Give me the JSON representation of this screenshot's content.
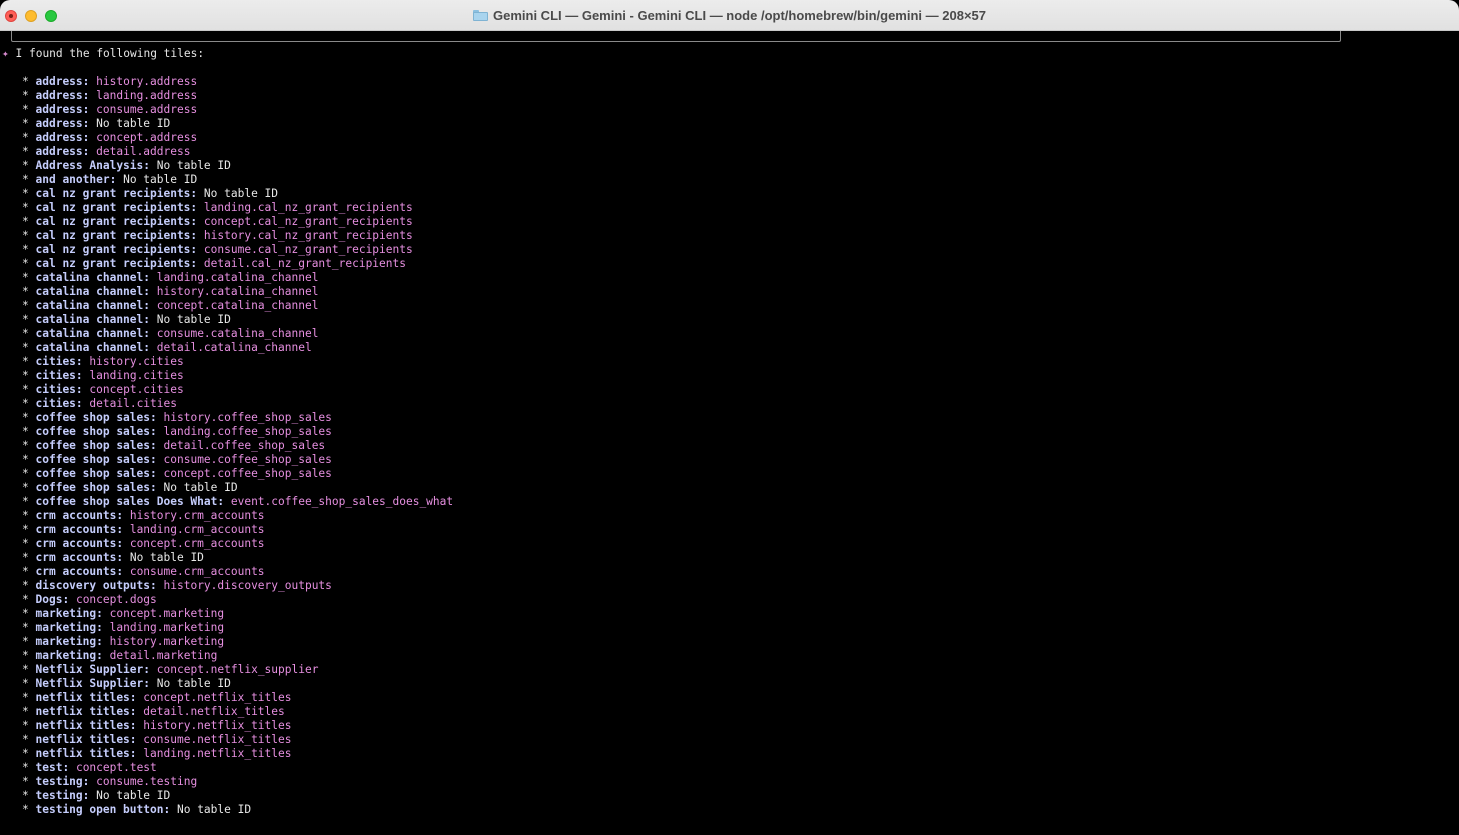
{
  "window": {
    "title": "Gemini CLI — Gemini - Gemini CLI — node /opt/homebrew/bin/gemini — 208×57",
    "folder_icon": "folder-icon"
  },
  "colors": {
    "background": "#000000",
    "key": "#c5cdfc",
    "table_id": "#e68fe0",
    "plain": "#e8e8e8",
    "spark": "#d98bd0"
  },
  "terminal": {
    "spark_glyph": "✦",
    "header": "I found the following tiles:",
    "bullet": "*",
    "items": [
      {
        "name": "address",
        "value": "history.address",
        "style": "pink"
      },
      {
        "name": "address",
        "value": "landing.address",
        "style": "pink"
      },
      {
        "name": "address",
        "value": "consume.address",
        "style": "pink"
      },
      {
        "name": "address",
        "value": "No table ID",
        "style": "white"
      },
      {
        "name": "address",
        "value": "concept.address",
        "style": "pink"
      },
      {
        "name": "address",
        "value": "detail.address",
        "style": "pink"
      },
      {
        "name": "Address Analysis",
        "value": "No table ID",
        "style": "white"
      },
      {
        "name": "and another",
        "value": "No table ID",
        "style": "white"
      },
      {
        "name": "cal nz grant recipients",
        "value": "No table ID",
        "style": "white"
      },
      {
        "name": "cal nz grant recipients",
        "value": "landing.cal_nz_grant_recipients",
        "style": "pink"
      },
      {
        "name": "cal nz grant recipients",
        "value": "concept.cal_nz_grant_recipients",
        "style": "pink"
      },
      {
        "name": "cal nz grant recipients",
        "value": "history.cal_nz_grant_recipients",
        "style": "pink"
      },
      {
        "name": "cal nz grant recipients",
        "value": "consume.cal_nz_grant_recipients",
        "style": "pink"
      },
      {
        "name": "cal nz grant recipients",
        "value": "detail.cal_nz_grant_recipients",
        "style": "pink"
      },
      {
        "name": "catalina channel",
        "value": "landing.catalina_channel",
        "style": "pink"
      },
      {
        "name": "catalina channel",
        "value": "history.catalina_channel",
        "style": "pink"
      },
      {
        "name": "catalina channel",
        "value": "concept.catalina_channel",
        "style": "pink"
      },
      {
        "name": "catalina channel",
        "value": "No table ID",
        "style": "white"
      },
      {
        "name": "catalina channel",
        "value": "consume.catalina_channel",
        "style": "pink"
      },
      {
        "name": "catalina channel",
        "value": "detail.catalina_channel",
        "style": "pink"
      },
      {
        "name": "cities",
        "value": "history.cities",
        "style": "pink"
      },
      {
        "name": "cities",
        "value": "landing.cities",
        "style": "pink"
      },
      {
        "name": "cities",
        "value": "concept.cities",
        "style": "pink"
      },
      {
        "name": "cities",
        "value": "detail.cities",
        "style": "pink"
      },
      {
        "name": "coffee shop sales",
        "value": "history.coffee_shop_sales",
        "style": "pink"
      },
      {
        "name": "coffee shop sales",
        "value": "landing.coffee_shop_sales",
        "style": "pink"
      },
      {
        "name": "coffee shop sales",
        "value": "detail.coffee_shop_sales",
        "style": "pink"
      },
      {
        "name": "coffee shop sales",
        "value": "consume.coffee_shop_sales",
        "style": "pink"
      },
      {
        "name": "coffee shop sales",
        "value": "concept.coffee_shop_sales",
        "style": "pink"
      },
      {
        "name": "coffee shop sales",
        "value": "No table ID",
        "style": "white"
      },
      {
        "name": "coffee shop sales Does What",
        "value": "event.coffee_shop_sales_does_what",
        "style": "pink"
      },
      {
        "name": "crm accounts",
        "value": "history.crm_accounts",
        "style": "pink"
      },
      {
        "name": "crm accounts",
        "value": "landing.crm_accounts",
        "style": "pink"
      },
      {
        "name": "crm accounts",
        "value": "concept.crm_accounts",
        "style": "pink"
      },
      {
        "name": "crm accounts",
        "value": "No table ID",
        "style": "white"
      },
      {
        "name": "crm accounts",
        "value": "consume.crm_accounts",
        "style": "pink"
      },
      {
        "name": "discovery outputs",
        "value": "history.discovery_outputs",
        "style": "pink"
      },
      {
        "name": "Dogs",
        "value": "concept.dogs",
        "style": "pink"
      },
      {
        "name": "marketing",
        "value": "concept.marketing",
        "style": "pink"
      },
      {
        "name": "marketing",
        "value": "landing.marketing",
        "style": "pink"
      },
      {
        "name": "marketing",
        "value": "history.marketing",
        "style": "pink"
      },
      {
        "name": "marketing",
        "value": "detail.marketing",
        "style": "pink"
      },
      {
        "name": "Netflix Supplier",
        "value": "concept.netflix_supplier",
        "style": "pink"
      },
      {
        "name": "Netflix Supplier",
        "value": "No table ID",
        "style": "white"
      },
      {
        "name": "netflix titles",
        "value": "concept.netflix_titles",
        "style": "pink"
      },
      {
        "name": "netflix titles",
        "value": "detail.netflix_titles",
        "style": "pink"
      },
      {
        "name": "netflix titles",
        "value": "history.netflix_titles",
        "style": "pink"
      },
      {
        "name": "netflix titles",
        "value": "consume.netflix_titles",
        "style": "pink"
      },
      {
        "name": "netflix titles",
        "value": "landing.netflix_titles",
        "style": "pink"
      },
      {
        "name": "test",
        "value": "concept.test",
        "style": "pink"
      },
      {
        "name": "testing",
        "value": "consume.testing",
        "style": "pink"
      },
      {
        "name": "testing",
        "value": "No table ID",
        "style": "white"
      },
      {
        "name": "testing open button",
        "value": "No table ID",
        "style": "white"
      }
    ]
  }
}
